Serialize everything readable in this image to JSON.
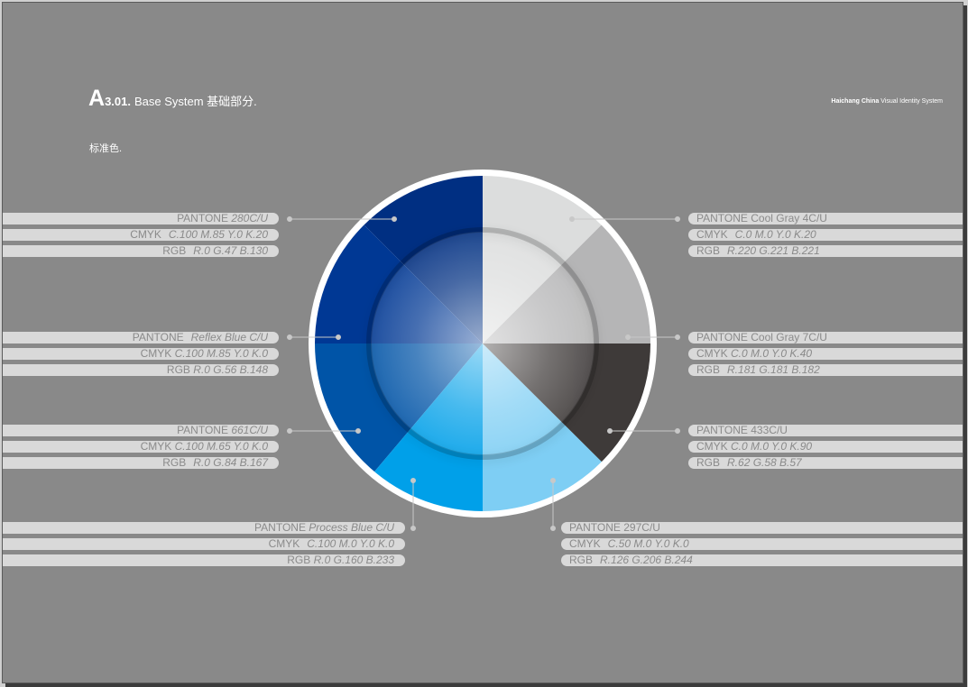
{
  "header": {
    "letter": "A",
    "section": "3.01.",
    "title": "Base System 基础部分.",
    "subtitle": "标准色.",
    "brand_bold": "Haichang China",
    "brand_rest": "Visual Identity System"
  },
  "colors_left": [
    {
      "pantone_label": "PANTONE",
      "pantone": "280C/U",
      "cmyk_label": "CMYK",
      "cmyk": "C.100  M.85  Y.0  K.20",
      "rgb_label": "RGB",
      "rgb": "R.0  G.47  B.130",
      "hex": "#002F82"
    },
    {
      "pantone_label": "PANTONE",
      "pantone": "Reflex Blue C/U",
      "cmyk_label": "CMYK",
      "cmyk": "C.100  M.85  Y.0  K.0",
      "rgb_label": "RGB",
      "rgb": "R.0  G.56  B.148",
      "hex": "#003894"
    },
    {
      "pantone_label": "PANTONE",
      "pantone": "661C/U",
      "cmyk_label": "CMYK",
      "cmyk": "C.100  M.65  Y.0  K.0",
      "rgb_label": "RGB",
      "rgb": "R.0  G.84  B.167",
      "hex": "#0054A7"
    },
    {
      "pantone_label": "PANTONE",
      "pantone": "Process Blue C/U",
      "cmyk_label": "CMYK",
      "cmyk": "C.100  M.0  Y.0  K.0",
      "rgb_label": "RGB",
      "rgb": "R.0  G.160  B.233",
      "hex": "#00A0E9"
    }
  ],
  "colors_right": [
    {
      "pantone_label": "PANTONE",
      "pantone": "Cool Gray 4C/U",
      "cmyk_label": "CMYK",
      "cmyk": "C.0  M.0  Y.0  K.20",
      "rgb_label": "RGB",
      "rgb": "R.220  G.221  B.221",
      "hex": "#DCDDDD"
    },
    {
      "pantone_label": "PANTONE",
      "pantone": "Cool Gray 7C/U",
      "cmyk_label": "CMYK",
      "cmyk": "C.0  M.0  Y.0  K.40",
      "rgb_label": "RGB",
      "rgb": "R.181  G.181  B.182",
      "hex": "#B5B5B6"
    },
    {
      "pantone_label": "PANTONE",
      "pantone": "433C/U",
      "cmyk_label": "CMYK",
      "cmyk": "C.0  M.0  Y.0  K.90",
      "rgb_label": "RGB",
      "rgb": "R.62  G.58  B.57",
      "hex": "#3E3A39"
    },
    {
      "pantone_label": "PANTONE",
      "pantone": "297C/U",
      "cmyk_label": "CMYK",
      "cmyk": "C.50  M.0  Y.0  K.0",
      "rgb_label": "RGB",
      "rgb": "R.126  G.206  B.244",
      "hex": "#7ECEF4"
    }
  ]
}
